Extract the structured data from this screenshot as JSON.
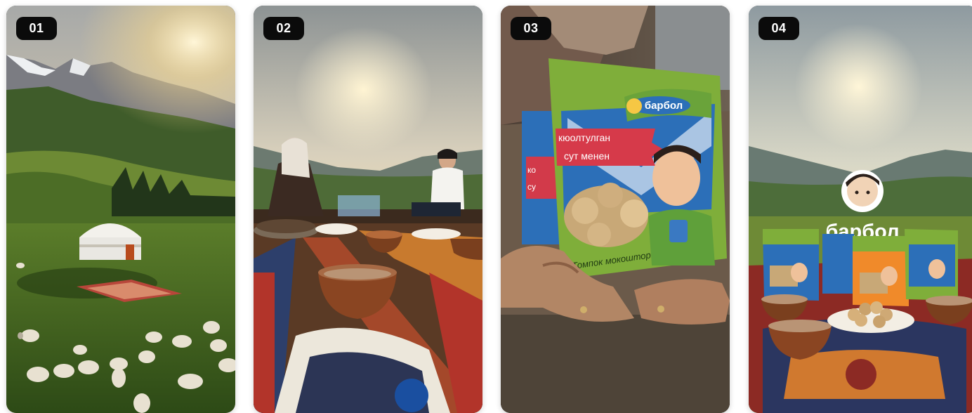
{
  "cards": [
    {
      "number": "01",
      "scene": "mountain-yurt-sunset-sheep"
    },
    {
      "number": "02",
      "scene": "tea-picnic-on-carpet"
    },
    {
      "number": "03",
      "scene": "hands-holding-barbol-package"
    },
    {
      "number": "04",
      "scene": "barbol-products-with-tea"
    }
  ],
  "package": {
    "brand": "барбол",
    "line1": "кюолтулган",
    "line2": "сут менен",
    "footer": "Томпок мокоштор",
    "side_fragment_1": "ко",
    "side_fragment_2": "су"
  },
  "card4": {
    "logo_text": "барбол"
  },
  "colors": {
    "badge_bg": "#0b0b0b",
    "badge_text": "#ffffff",
    "package_green": "#7fae3a",
    "package_blue": "#2c6fb8",
    "carpet_red": "#9c2b22"
  }
}
